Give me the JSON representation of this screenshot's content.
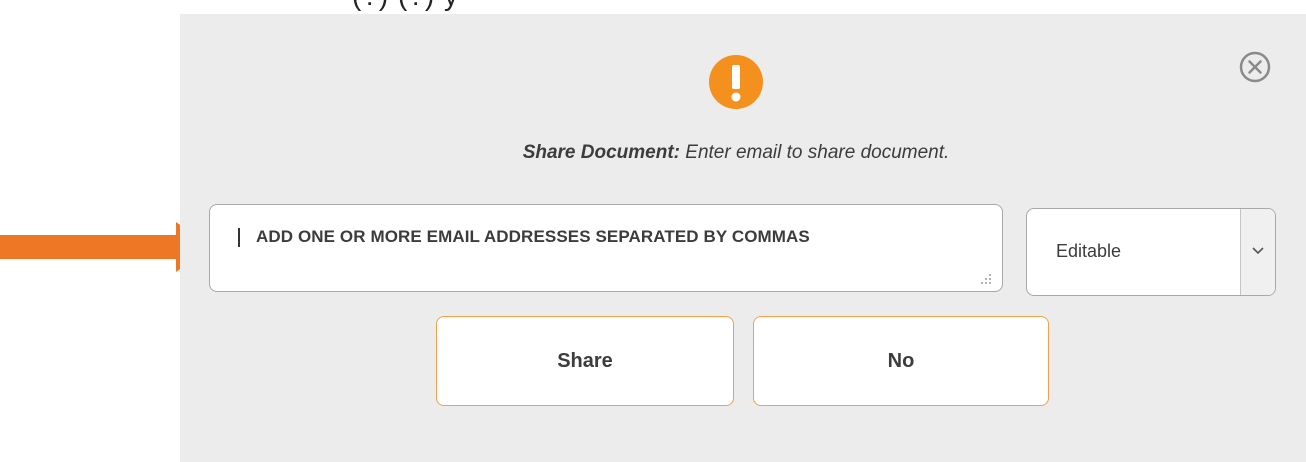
{
  "top_fragment": "(?)                    (?)          y",
  "dialog": {
    "message_title": "Share Document:",
    "message_text": " Enter email to share document.",
    "email_placeholder": "ADD ONE OR MORE EMAIL ADDRESSES SEPARATED BY COMMAS",
    "permission_value": "Editable",
    "share_label": "Share",
    "no_label": "No"
  },
  "icons": {
    "warning": "exclamation-circle-icon",
    "close": "close-circle-icon",
    "chevron": "chevron-down-icon",
    "arrow": "arrow-right-icon",
    "resize": "resize-grip-icon"
  },
  "colors": {
    "dialog_bg": "#ececec",
    "accent_orange": "#f4901e",
    "arrow_orange": "#ee7726",
    "button_border": "#f4a04a"
  }
}
